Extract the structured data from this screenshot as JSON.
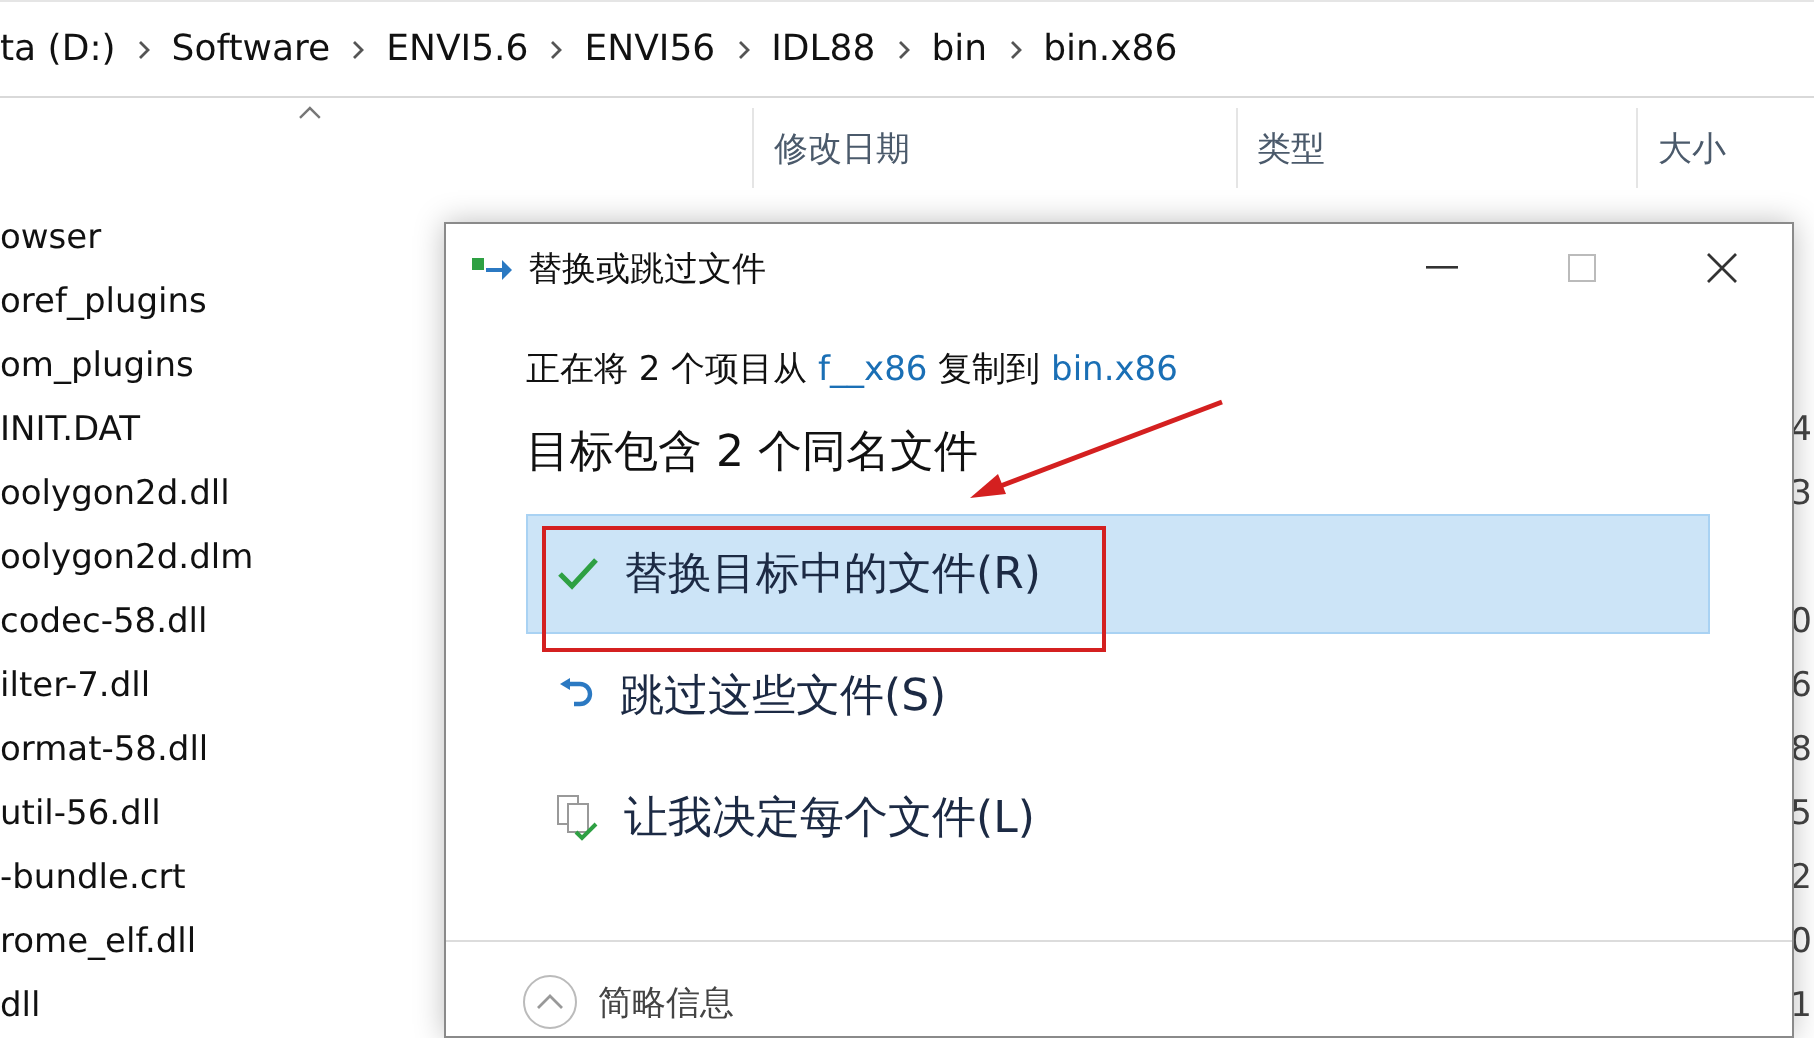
{
  "address_bar": {
    "crumbs": [
      "ta (D:)",
      "Software",
      "ENVI5.6",
      "ENVI56",
      "IDL88",
      "bin",
      "bin.x86"
    ]
  },
  "columns": [
    "修改日期",
    "类型",
    "大小"
  ],
  "files": [
    {
      "name": "owser"
    },
    {
      "name": "oref_plugins"
    },
    {
      "name": "om_plugins"
    },
    {
      "name": "INIT.DAT",
      "size": "4"
    },
    {
      "name": "oolygon2d.dll",
      "size": "3"
    },
    {
      "name": "oolygon2d.dlm"
    },
    {
      "name": "codec-58.dll",
      "size": "0"
    },
    {
      "name": "ilter-7.dll",
      "size": "6"
    },
    {
      "name": "ormat-58.dll",
      "size": "8"
    },
    {
      "name": "util-56.dll",
      "size": "5"
    },
    {
      "name": "-bundle.crt",
      "size": "2"
    },
    {
      "name": "rome_elf.dll",
      "size": "0"
    },
    {
      "name": "dll",
      "size": "1"
    }
  ],
  "dialog": {
    "title": "替换或跳过文件",
    "copy_line": [
      {
        "kind": "plain",
        "text": "正在将 2 个项目从 "
      },
      {
        "kind": "link",
        "text": "f__x86"
      },
      {
        "kind": "plain",
        "text": " 复制到 "
      },
      {
        "kind": "link",
        "text": "bin.x86"
      }
    ],
    "heading": "目标包含 2 个同名文件",
    "options": [
      {
        "kind": "replace",
        "label": "替换目标中的文件(R)",
        "selected": true
      },
      {
        "kind": "skip",
        "label": "跳过这些文件(S)",
        "selected": false
      },
      {
        "kind": "decide",
        "label": "让我决定每个文件(L)",
        "selected": false
      }
    ],
    "details_toggle": "简略信息"
  }
}
